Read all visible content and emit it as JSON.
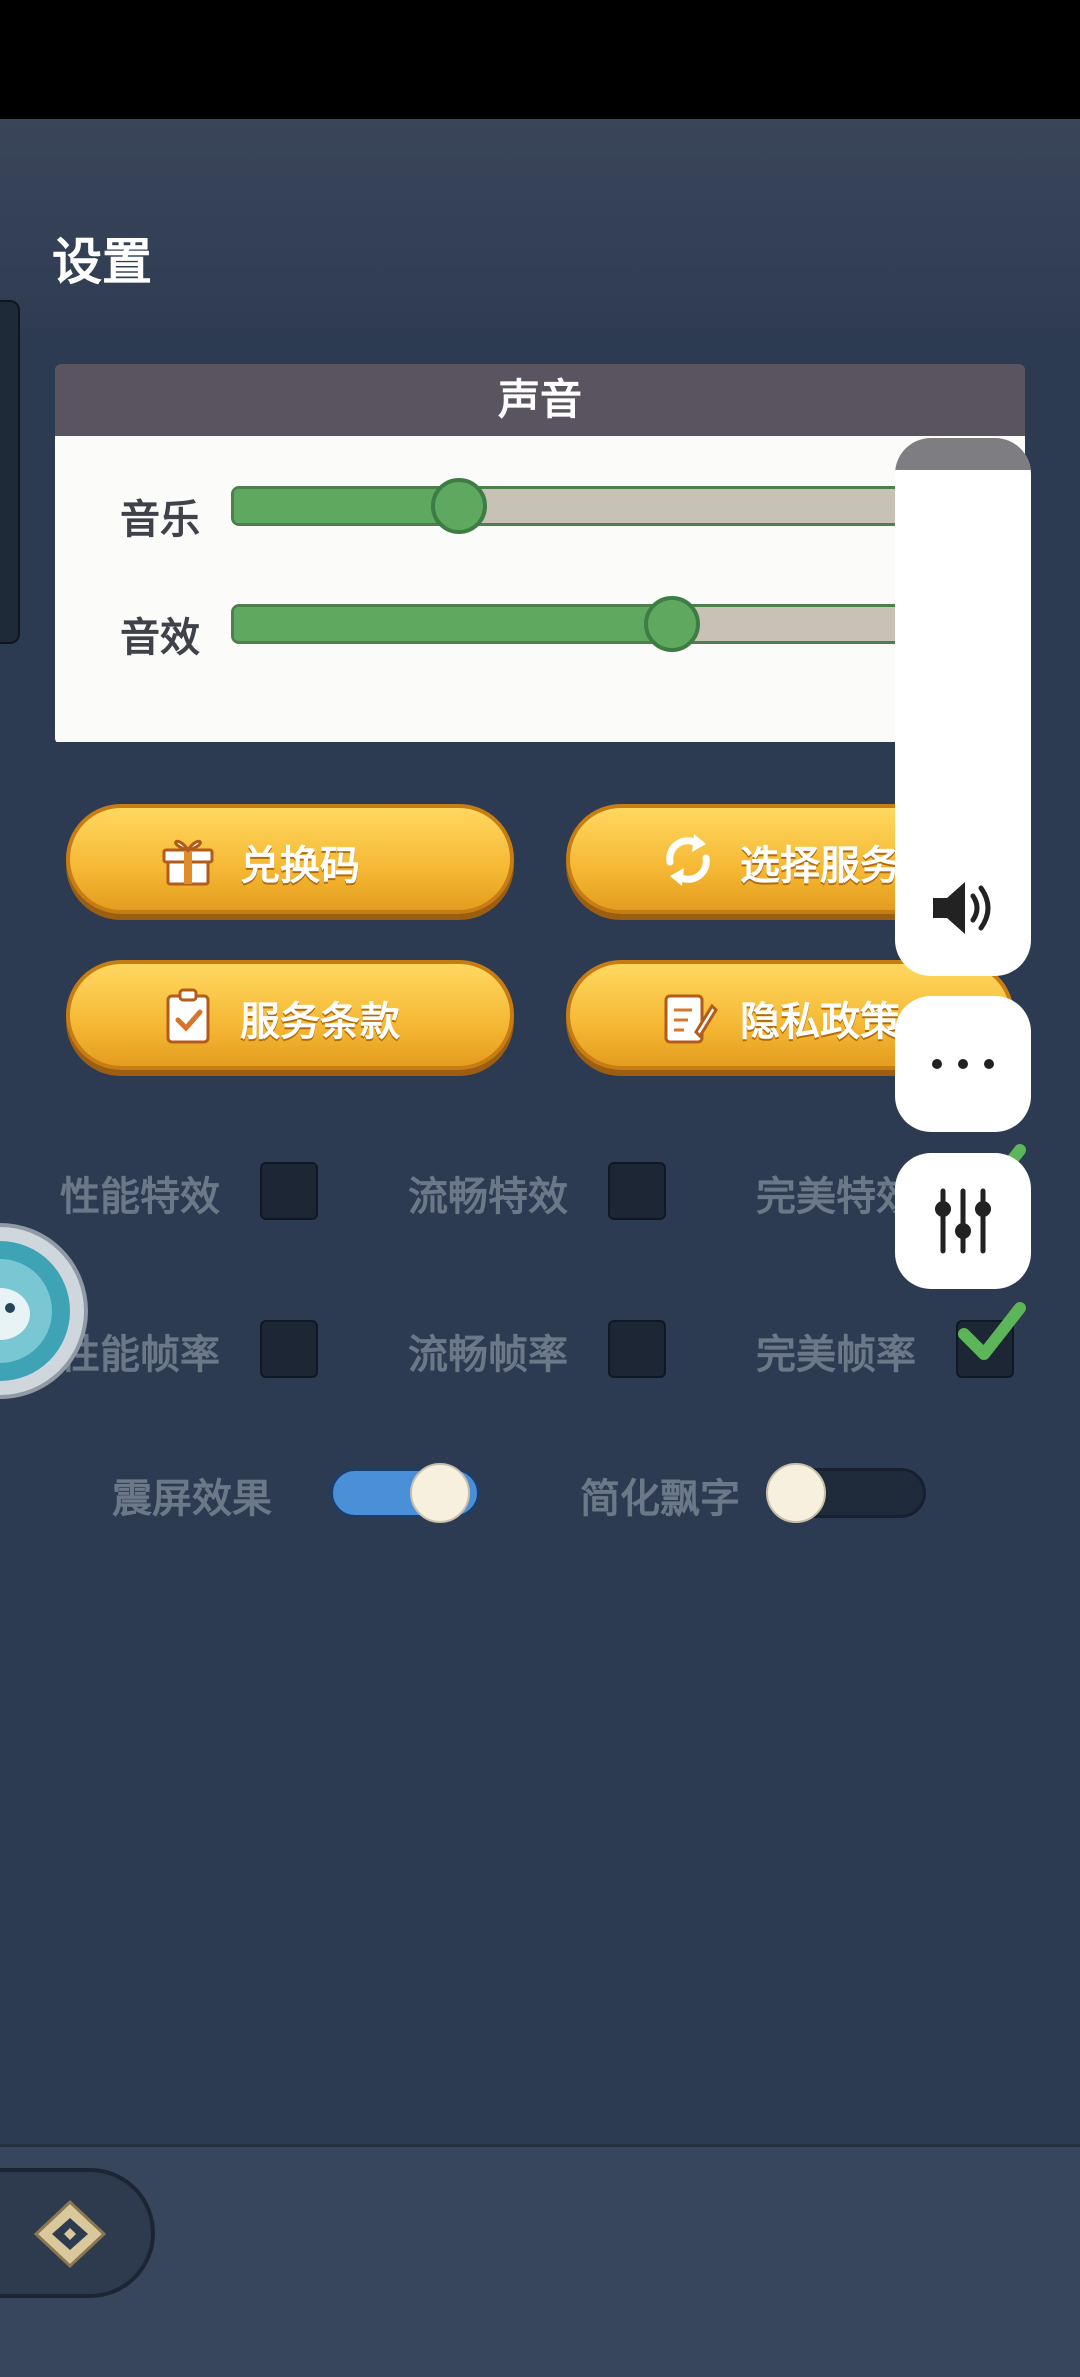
{
  "page": {
    "title": "设置"
  },
  "sound": {
    "header": "声音",
    "music_label": "音乐",
    "music_level": 0.3,
    "sfx_label": "音效",
    "sfx_level": 0.58
  },
  "buttons": {
    "redeem": "兑换码",
    "select_server": "选择服务",
    "terms": "服务条款",
    "privacy": "隐私政策"
  },
  "effects": {
    "performance": "性能特效",
    "smooth": "流畅特效",
    "perfect": "完美特效",
    "selected": "perfect"
  },
  "framerate": {
    "performance": "性能帧率",
    "smooth": "流畅帧率",
    "perfect": "完美帧率",
    "selected": "perfect"
  },
  "toggles": {
    "shake_label": "震屏效果",
    "shake_on": true,
    "simplify_label": "简化飘字",
    "simplify_on": false
  },
  "colors": {
    "accent_green": "#5ea85f",
    "button_gold": "#f5b834",
    "toggle_on_blue": "#4a90d9",
    "background": "#2d3b52"
  },
  "icons": [
    "gift-icon",
    "refresh-icon",
    "clipboard-check-icon",
    "edit-document-icon",
    "check-icon",
    "speaker-icon",
    "more-icon",
    "equalizer-icon",
    "home-icon"
  ]
}
